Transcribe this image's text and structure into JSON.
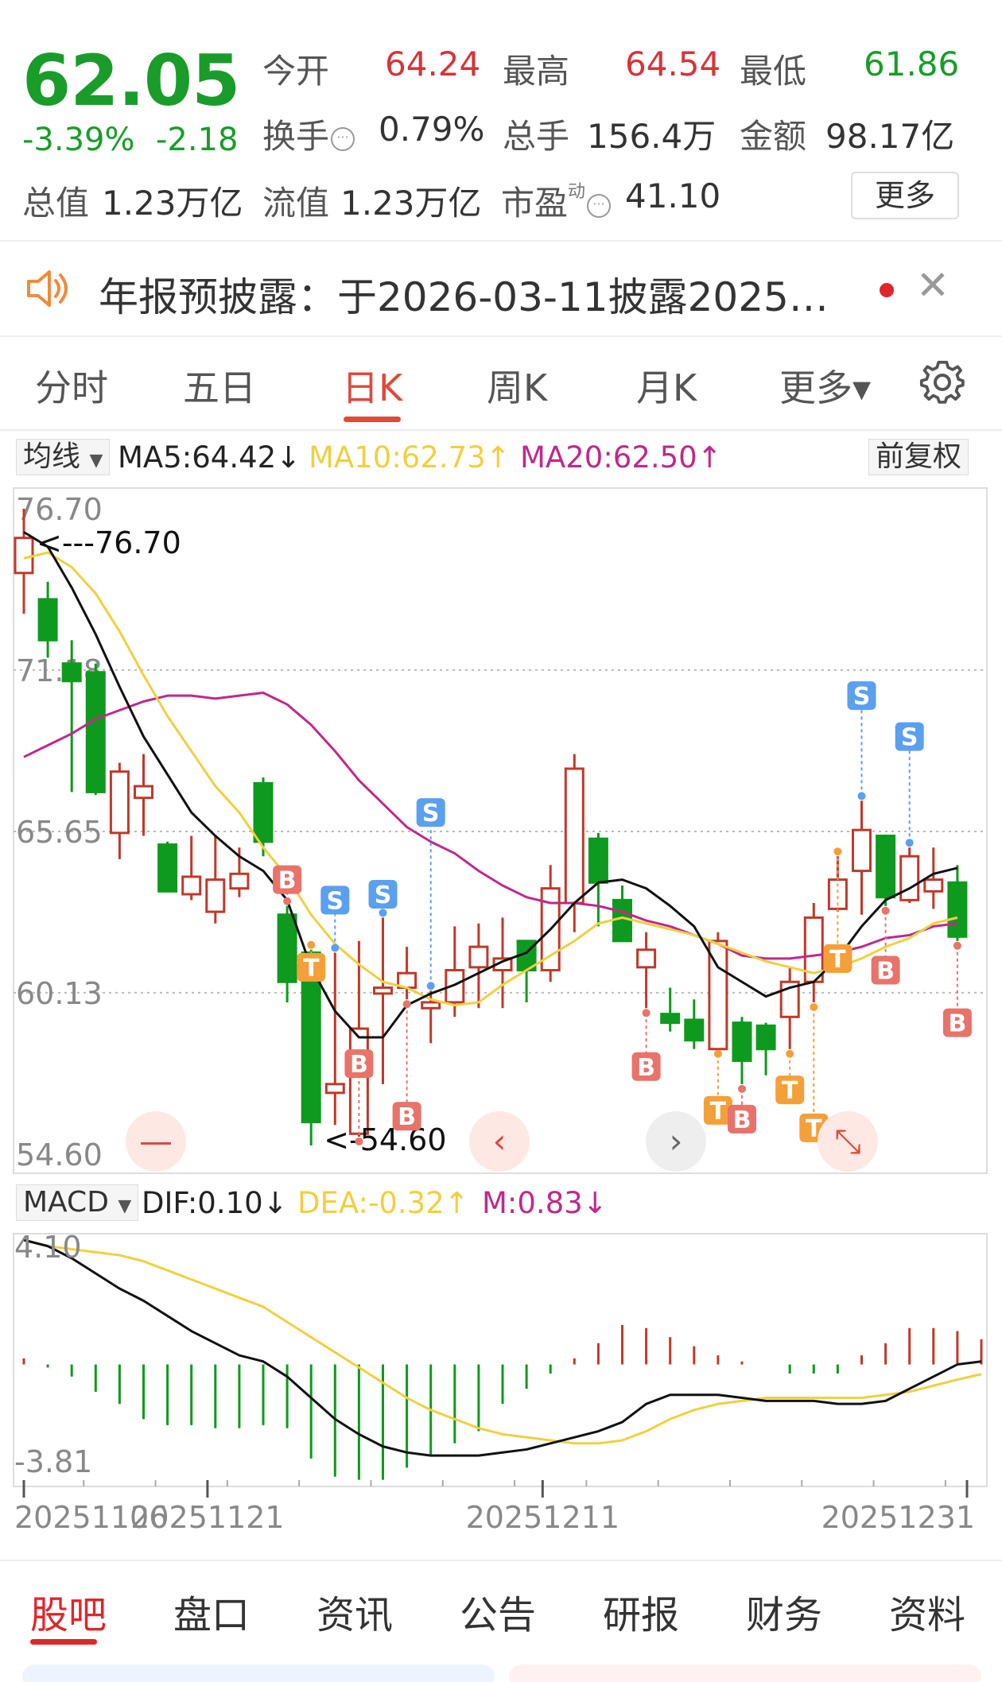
{
  "quote": {
    "price": "62.05",
    "change_pct": "-3.39%",
    "change_abs": "-2.18",
    "open_label": "今开",
    "open_value": "64.24",
    "high_label": "最高",
    "high_value": "64.54",
    "low_label": "最低",
    "low_value": "61.86",
    "turnover_label": "换手",
    "turnover_value": "0.79%",
    "volume_label": "总手",
    "volume_value": "156.4万",
    "amount_label": "金额",
    "amount_value": "98.17亿",
    "mktcap_label": "总值",
    "mktcap_value": "1.23万亿",
    "float_label": "流值",
    "float_value": "1.23万亿",
    "pe_label": "市盈",
    "pe_sup": "动",
    "pe_value": "41.10",
    "more_label": "更多"
  },
  "notice": {
    "text": "年报预披露：于2026-03-11披露2025…",
    "close_glyph": "✕"
  },
  "period_tabs": [
    {
      "label": "分时"
    },
    {
      "label": "五日"
    },
    {
      "label": "日K"
    },
    {
      "label": "周K"
    },
    {
      "label": "月K"
    },
    {
      "label": "更多▾"
    }
  ],
  "ma_legend": {
    "selector": "均线",
    "ma5": "MA5:64.42↓",
    "ma10": "MA10:62.73↑",
    "ma20": "MA20:62.50↑",
    "adjust": "前复权"
  },
  "macd_legend": {
    "selector": "MACD",
    "dif": "DIF:0.10↓",
    "dea": "DEA:-0.32↑",
    "m": "M:0.83↓"
  },
  "colors": {
    "up": "#c0392b",
    "down": "#0e9a1e",
    "ma5": "#111111",
    "ma10": "#f0d040",
    "ma20": "#c0288c",
    "accent": "#e0493b",
    "buy": "#e8736a",
    "sell": "#5aa0ee",
    "t": "#f4a03a"
  },
  "chart_data": [
    {
      "type": "candlestick",
      "ylim": [
        54.6,
        76.7
      ],
      "y_ticks": [
        "76.70",
        "71.18",
        "65.65",
        "60.13",
        "54.60"
      ],
      "max_annotation": "<---76.70",
      "min_annotation": "<-54.60",
      "candles": [
        {
          "o": 74.5,
          "h": 76.7,
          "l": 73.1,
          "c": 75.7
        },
        {
          "o": 73.6,
          "h": 74.2,
          "l": 71.6,
          "c": 72.2
        },
        {
          "o": 71.4,
          "h": 72.2,
          "l": 67.0,
          "c": 70.8
        },
        {
          "o": 71.1,
          "h": 71.4,
          "l": 66.9,
          "c": 67.0
        },
        {
          "o": 65.6,
          "h": 68.0,
          "l": 64.7,
          "c": 67.7
        },
        {
          "o": 66.8,
          "h": 68.3,
          "l": 65.5,
          "c": 67.2
        },
        {
          "o": 65.2,
          "h": 65.3,
          "l": 63.6,
          "c": 63.6
        },
        {
          "o": 63.5,
          "h": 65.5,
          "l": 63.3,
          "c": 64.1
        },
        {
          "o": 62.9,
          "h": 65.5,
          "l": 62.5,
          "c": 64.0
        },
        {
          "o": 63.7,
          "h": 65.1,
          "l": 63.4,
          "c": 64.2
        },
        {
          "o": 67.3,
          "h": 67.5,
          "l": 64.8,
          "c": 65.3
        },
        {
          "o": 62.8,
          "h": 63.1,
          "l": 59.8,
          "c": 60.5
        },
        {
          "o": 61.5,
          "h": 61.6,
          "l": 54.9,
          "c": 55.7
        },
        {
          "o": 56.7,
          "h": 61.5,
          "l": 55.6,
          "c": 57.0
        },
        {
          "o": 55.3,
          "h": 61.9,
          "l": 55.2,
          "c": 58.9
        },
        {
          "o": 60.1,
          "h": 62.7,
          "l": 57.0,
          "c": 60.3
        },
        {
          "o": 60.3,
          "h": 61.7,
          "l": 59.9,
          "c": 60.8
        },
        {
          "o": 59.6,
          "h": 60.2,
          "l": 58.4,
          "c": 59.8
        },
        {
          "o": 59.8,
          "h": 62.4,
          "l": 59.3,
          "c": 60.9
        },
        {
          "o": 61.0,
          "h": 62.5,
          "l": 59.6,
          "c": 61.7
        },
        {
          "o": 60.9,
          "h": 62.7,
          "l": 59.6,
          "c": 61.3
        },
        {
          "o": 61.9,
          "h": 61.9,
          "l": 59.8,
          "c": 60.9
        },
        {
          "o": 60.9,
          "h": 64.5,
          "l": 60.5,
          "c": 63.7
        },
        {
          "o": 63.2,
          "h": 68.3,
          "l": 62.2,
          "c": 67.8
        },
        {
          "o": 65.4,
          "h": 65.6,
          "l": 62.4,
          "c": 63.9
        },
        {
          "o": 63.3,
          "h": 63.8,
          "l": 61.9,
          "c": 61.9
        },
        {
          "o": 61.0,
          "h": 62.2,
          "l": 59.6,
          "c": 61.6
        },
        {
          "o": 59.4,
          "h": 60.3,
          "l": 58.8,
          "c": 59.1
        },
        {
          "o": 59.2,
          "h": 59.9,
          "l": 58.2,
          "c": 58.5
        },
        {
          "o": 58.2,
          "h": 62.2,
          "l": 58.2,
          "c": 61.9
        },
        {
          "o": 59.1,
          "h": 59.3,
          "l": 57.0,
          "c": 57.8
        },
        {
          "o": 59.0,
          "h": 59.1,
          "l": 57.3,
          "c": 58.2
        },
        {
          "o": 59.3,
          "h": 61.0,
          "l": 58.2,
          "c": 60.5
        },
        {
          "o": 60.5,
          "h": 63.2,
          "l": 59.8,
          "c": 62.7
        },
        {
          "o": 63.0,
          "h": 64.8,
          "l": 62.9,
          "c": 64.0
        },
        {
          "o": 64.3,
          "h": 66.7,
          "l": 62.8,
          "c": 65.7
        },
        {
          "o": 65.5,
          "h": 65.5,
          "l": 63.1,
          "c": 63.4
        },
        {
          "o": 63.3,
          "h": 65.1,
          "l": 63.2,
          "c": 64.8
        },
        {
          "o": 63.6,
          "h": 65.1,
          "l": 63.0,
          "c": 64.0
        },
        {
          "o": 63.9,
          "h": 64.5,
          "l": 61.9,
          "c": 62.05
        }
      ],
      "ma5": [
        75.9,
        75.4,
        74.0,
        72.4,
        70.6,
        68.9,
        67.6,
        66.3,
        65.5,
        64.8,
        64.3,
        63.3,
        61.0,
        59.5,
        58.6,
        58.6,
        59.7,
        60.1,
        60.4,
        60.8,
        61.2,
        61.5,
        62.3,
        63.2,
        63.9,
        64.0,
        63.7,
        63.1,
        62.4,
        61.0,
        60.5,
        60.0,
        60.3,
        60.5,
        61.3,
        62.4,
        63.3,
        63.7,
        64.2,
        64.4
      ],
      "ma10": [
        75.0,
        75.2,
        74.7,
        73.8,
        72.5,
        71.0,
        69.6,
        68.4,
        67.2,
        66.3,
        65.1,
        64.1,
        62.8,
        61.8,
        61.1,
        60.5,
        60.3,
        59.9,
        59.7,
        59.8,
        60.4,
        60.9,
        61.4,
        61.9,
        62.5,
        62.7,
        62.5,
        62.3,
        62.1,
        61.8,
        61.5,
        61.2,
        61.0,
        60.8,
        61.0,
        61.3,
        61.7,
        62.0,
        62.5,
        62.7
      ],
      "ma20": [
        68.2,
        68.6,
        69.0,
        69.5,
        69.8,
        70.1,
        70.3,
        70.3,
        70.2,
        70.3,
        70.4,
        70.0,
        69.3,
        68.4,
        67.4,
        66.6,
        65.8,
        65.3,
        64.9,
        64.3,
        63.8,
        63.4,
        63.2,
        63.2,
        63.1,
        62.9,
        62.6,
        62.4,
        62.1,
        61.8,
        61.4,
        61.3,
        61.3,
        61.4,
        61.5,
        61.7,
        62.0,
        62.1,
        62.4,
        62.5
      ],
      "signals": [
        {
          "i": 12,
          "label": "B",
          "kind": "buy",
          "pos": "above",
          "price": 64.0
        },
        {
          "i": 13,
          "label": "T",
          "kind": "t",
          "pos": "above",
          "price": 61.0
        },
        {
          "i": 14,
          "label": "S",
          "kind": "sell",
          "pos": "above",
          "price": 63.3
        },
        {
          "i": 15,
          "label": "B",
          "kind": "buy",
          "pos": "below",
          "price": 57.7
        },
        {
          "i": 16,
          "label": "S",
          "kind": "sell",
          "pos": "above",
          "price": 63.5
        },
        {
          "i": 17,
          "label": "B",
          "kind": "buy",
          "pos": "below",
          "price": 55.9
        },
        {
          "i": 18,
          "label": "S",
          "kind": "sell",
          "pos": "above",
          "price": 66.3
        },
        {
          "i": 27,
          "label": "B",
          "kind": "buy",
          "pos": "below",
          "price": 57.6
        },
        {
          "i": 30,
          "label": "T",
          "kind": "t",
          "pos": "below",
          "price": 56.1
        },
        {
          "i": 31,
          "label": "B",
          "kind": "buy",
          "pos": "below",
          "price": 55.8
        },
        {
          "i": 33,
          "label": "T",
          "kind": "t",
          "pos": "below",
          "price": 56.8
        },
        {
          "i": 34,
          "label": "T",
          "kind": "t",
          "pos": "below",
          "price": 55.5
        },
        {
          "i": 35,
          "label": "T",
          "kind": "t",
          "pos": "above",
          "price": 61.3
        },
        {
          "i": 36,
          "label": "S",
          "kind": "sell",
          "pos": "above",
          "price": 70.3
        },
        {
          "i": 37,
          "label": "B",
          "kind": "buy",
          "pos": "below",
          "price": 60.9
        },
        {
          "i": 38,
          "label": "S",
          "kind": "sell",
          "pos": "above",
          "price": 68.9
        },
        {
          "i": 40,
          "label": "B",
          "kind": "buy",
          "pos": "below",
          "price": 59.1
        }
      ],
      "nav_buttons": [
        "—",
        "‹",
        "›",
        "⤡"
      ]
    },
    {
      "type": "macd",
      "ylim": [
        -3.81,
        4.1
      ],
      "y_ticks": [
        "4.10",
        "-3.81"
      ],
      "x_ticks": [
        "20251106",
        "20251121",
        "20251211",
        "20251231"
      ],
      "dif": [
        4.1,
        3.9,
        3.5,
        3.0,
        2.5,
        2.1,
        1.6,
        1.1,
        0.7,
        0.3,
        0.1,
        -0.4,
        -1.1,
        -1.8,
        -2.3,
        -2.7,
        -2.9,
        -3.0,
        -3.0,
        -3.0,
        -2.9,
        -2.8,
        -2.6,
        -2.4,
        -2.2,
        -1.9,
        -1.3,
        -1.0,
        -1.0,
        -1.0,
        -1.1,
        -1.2,
        -1.2,
        -1.2,
        -1.3,
        -1.3,
        -1.2,
        -0.8,
        -0.4,
        0.0,
        0.1
      ],
      "dea": [
        4.1,
        3.9,
        3.8,
        3.7,
        3.6,
        3.4,
        3.1,
        2.8,
        2.5,
        2.2,
        1.9,
        1.4,
        0.9,
        0.4,
        -0.1,
        -0.6,
        -1.1,
        -1.5,
        -1.8,
        -2.1,
        -2.3,
        -2.4,
        -2.5,
        -2.6,
        -2.6,
        -2.5,
        -2.2,
        -1.8,
        -1.5,
        -1.3,
        -1.2,
        -1.1,
        -1.1,
        -1.1,
        -1.1,
        -1.1,
        -1.0,
        -0.9,
        -0.7,
        -0.5,
        -0.32
      ],
      "m": [
        0.2,
        -0.1,
        -0.4,
        -0.9,
        -1.3,
        -1.8,
        -2.0,
        -2.0,
        -2.1,
        -2.1,
        -2.0,
        -2.1,
        -3.1,
        -3.7,
        -3.8,
        -3.8,
        -3.4,
        -3.0,
        -2.6,
        -2.2,
        -1.3,
        -0.8,
        -0.3,
        0.2,
        0.7,
        1.3,
        1.2,
        0.9,
        0.6,
        0.3,
        0.1,
        0.0,
        -0.3,
        -0.3,
        -0.3,
        0.3,
        0.7,
        1.2,
        1.2,
        1.1,
        0.83
      ]
    }
  ],
  "bottom_tabs": [
    {
      "label": "股吧"
    },
    {
      "label": "盘口"
    },
    {
      "label": "资讯"
    },
    {
      "label": "公告"
    },
    {
      "label": "研报"
    },
    {
      "label": "财务"
    },
    {
      "label": "资料"
    }
  ]
}
